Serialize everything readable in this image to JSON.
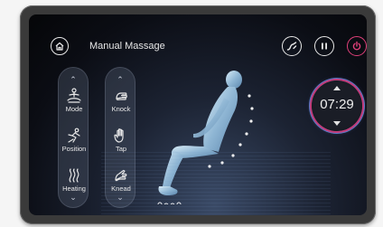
{
  "header": {
    "title": "Manual Massage",
    "home_icon": "home-icon",
    "zero_gravity_icon": "zero-gravity-icon",
    "pause_icon": "pause-icon",
    "power_icon": "power-icon",
    "power_color": "#e0407a"
  },
  "left_panel": {
    "items": [
      {
        "label": "Mode",
        "icon": "meditation-icon"
      },
      {
        "label": "Position",
        "icon": "stretch-icon"
      },
      {
        "label": "Heating",
        "icon": "heating-icon"
      }
    ]
  },
  "right_panel": {
    "items": [
      {
        "label": "Knock",
        "icon": "knock-hand-icon"
      },
      {
        "label": "Tap",
        "icon": "tap-hand-icon"
      },
      {
        "label": "Knead",
        "icon": "knead-hand-icon"
      }
    ]
  },
  "timer": {
    "value": "07:29",
    "ring_colors": [
      "#c23b78",
      "#5a79c8"
    ]
  }
}
